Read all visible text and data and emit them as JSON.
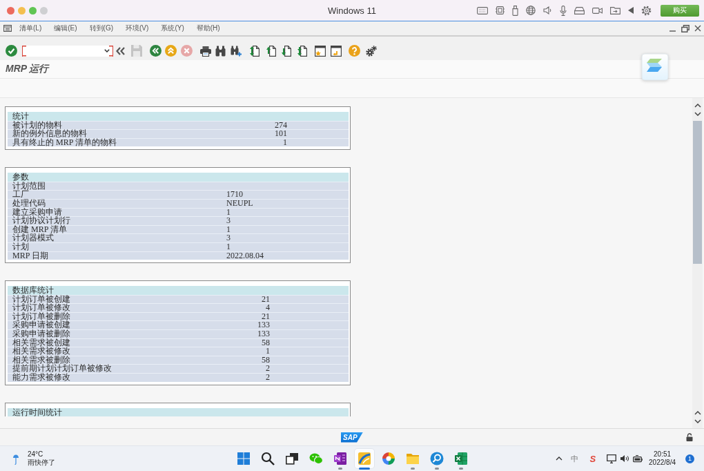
{
  "window": {
    "title": "Windows 11",
    "buy_button": "购买"
  },
  "sap": {
    "menu": [
      "清单(L)",
      "编辑(E)",
      "转到(G)",
      "环境(V)",
      "系统(Y)",
      "帮助(H)"
    ],
    "toolbar": {
      "save_disabled": true,
      "cancel_disabled": true
    },
    "screen_title": "MRP 运行",
    "sections": [
      {
        "title": "统计",
        "rows": [
          {
            "label": "被计划的物料",
            "value": "274"
          },
          {
            "label": "新的例外信息的物料",
            "value": "101"
          },
          {
            "label": "具有终止的 MRP 清单的物料",
            "value": "1"
          }
        ]
      },
      {
        "title": "参数",
        "rows": [
          {
            "label": "计划范围"
          },
          {
            "label": "工厂",
            "value": "1710"
          },
          {
            "label": "处理代码",
            "value": "NEUPL"
          },
          {
            "label": "建立采购申请",
            "value": "1"
          },
          {
            "label": "计划协议计划行",
            "value": "3"
          },
          {
            "label": "创建 MRP 清单",
            "value": "1"
          },
          {
            "label": "计划器模式",
            "value": "3"
          },
          {
            "label": "计划",
            "value": "1"
          },
          {
            "label": "MRP 日期",
            "value": "2022.08.04"
          }
        ]
      },
      {
        "title": "数据库统计",
        "rows": [
          {
            "label": "计划订单被创建",
            "value": "21"
          },
          {
            "label": "计划订单被修改",
            "value": "4"
          },
          {
            "label": "计划订单被删除",
            "value": "21"
          },
          {
            "label": "采购申请被创建",
            "value": "133"
          },
          {
            "label": "采购申请被删除",
            "value": "133"
          },
          {
            "label": "相关需求被创建",
            "value": "58"
          },
          {
            "label": "相关需求被修改",
            "value": "1"
          },
          {
            "label": "相关需求被删除",
            "value": "58"
          },
          {
            "label": "提前期计划计划订单被修改",
            "value": "2"
          },
          {
            "label": "能力需求被修改",
            "value": "2"
          }
        ]
      },
      {
        "title": "运行时间统计"
      }
    ],
    "status_bar": {
      "logo": "SAP"
    }
  },
  "taskbar": {
    "weather": {
      "temperature": "24°C",
      "condition": "雨快停了"
    },
    "apps": [
      {
        "kind": "start",
        "running": false,
        "selected": false
      },
      {
        "kind": "search",
        "running": false,
        "selected": false
      },
      {
        "kind": "taskview",
        "running": false,
        "selected": false
      },
      {
        "kind": "chat",
        "running": false,
        "selected": false
      },
      {
        "kind": "notebook",
        "running": true,
        "selected": false
      },
      {
        "kind": "logon",
        "running": true,
        "selected": true
      },
      {
        "kind": "colorwheel",
        "running": false,
        "selected": false
      },
      {
        "kind": "folder",
        "running": true,
        "selected": false
      },
      {
        "kind": "finder",
        "running": true,
        "selected": false
      },
      {
        "kind": "sheet",
        "running": true,
        "selected": false
      }
    ],
    "tray": {
      "input_method": "中",
      "ime_logo": "S",
      "time": "20:51",
      "date": "2022/8/4",
      "notifications": "1"
    }
  }
}
